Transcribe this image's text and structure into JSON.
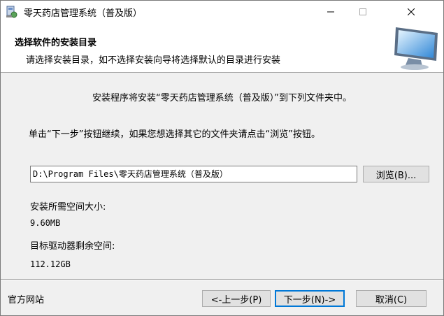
{
  "window": {
    "title": "零天药店管理系统（普及版）",
    "controls": {
      "minimize_icon": "minimize-icon",
      "maximize_icon": "maximize-icon",
      "close_icon": "close-icon"
    }
  },
  "header": {
    "title": "选择软件的安装目录",
    "subtitle": "请选择安装目录，如不选择安装向导将选择默认的目录进行安装",
    "graphic_icon": "monitor-icon"
  },
  "body": {
    "intro": "安装程序将安装“零天药店管理系统（普及版）”到下列文件夹中。",
    "instruction": "单击“下一步”按钮继续，如果您想选择其它的文件夹请点击“浏览”按钮。",
    "install_path": "D:\\Program Files\\零天药店管理系统（普及版）",
    "browse_label": "浏览(B)...",
    "space_required_label": "安装所需空间大小:",
    "space_required_value": "9.60MB",
    "space_available_label": "目标驱动器剩余空间:",
    "space_available_value": "112.12GB"
  },
  "footer": {
    "website_label": "官方网站",
    "back_label": "<-上一步(P)",
    "next_label": "下一步(N)->",
    "cancel_label": "取消(C)"
  },
  "colors": {
    "focus": "#0078d7",
    "button_bg": "#e1e1e1",
    "window_bg": "#f0f0f0"
  }
}
